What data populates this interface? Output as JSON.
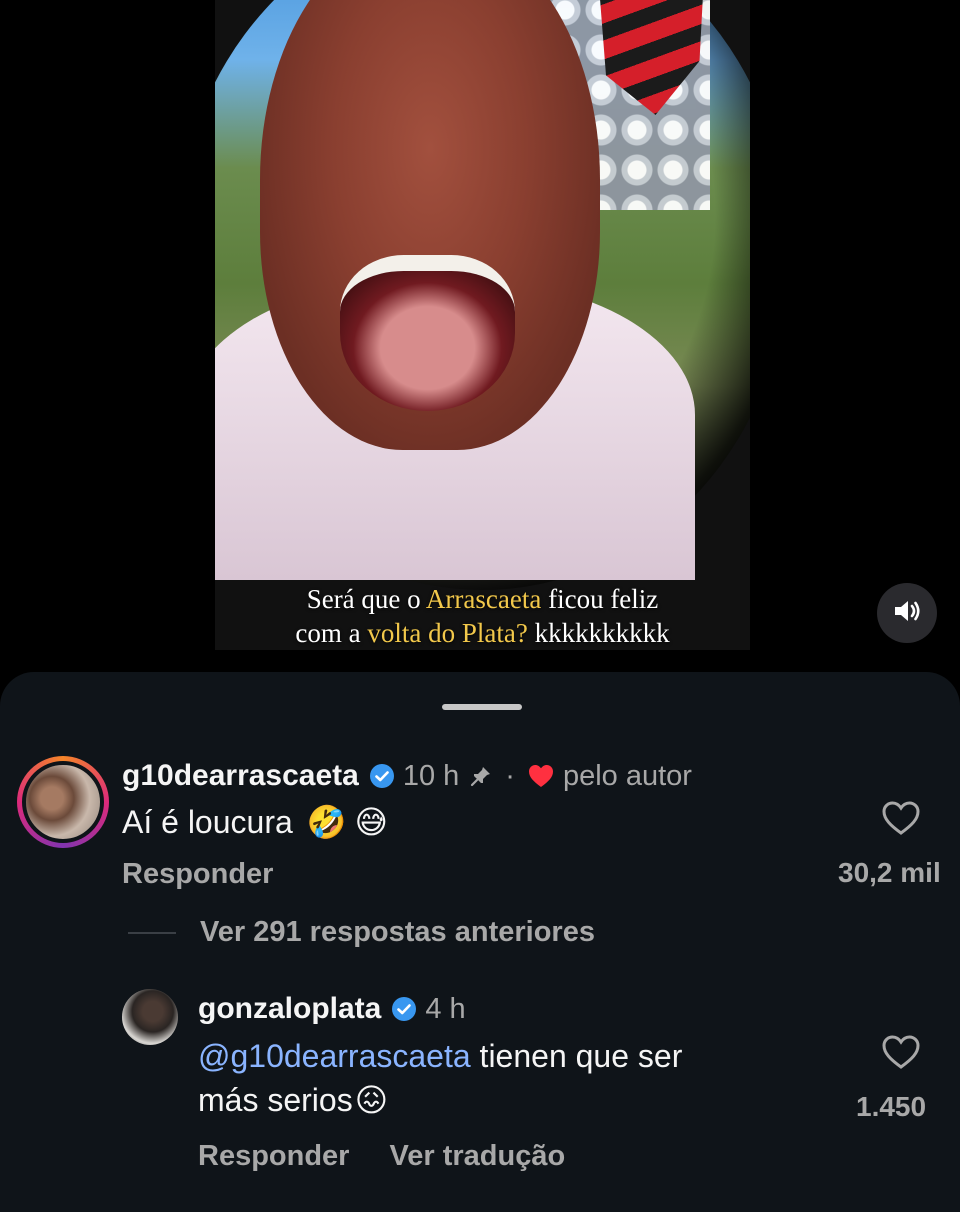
{
  "video": {
    "caption": {
      "line1_before": "Será que o ",
      "line1_highlight": "Arrascaeta",
      "line1_after": " ficou feliz",
      "line2_before": "com a ",
      "line2_highlight": "volta do Plata?",
      "line2_after": " kkkkkkkkkk"
    },
    "mute_icon": "speaker-icon",
    "highlight_color": "#f2c84b"
  },
  "comments": [
    {
      "username": "g10dearrascaeta",
      "verified": true,
      "time": "10 h",
      "pinned": true,
      "separator": "·",
      "liked_by_author_label": "pelo autor",
      "text": "Aí é loucura",
      "emojis": [
        "🤣",
        "😅"
      ],
      "reply_label": "Responder",
      "likes": "30,2 mil"
    }
  ],
  "replies_toggle": {
    "label": "Ver 291 respostas anteriores"
  },
  "replies": [
    {
      "username": "gonzaloplata",
      "verified": true,
      "time": "4 h",
      "mention": "@g10dearrascaeta",
      "text_line1": " tienen que ser",
      "text_line2": "más serios",
      "emoji": "😖",
      "reply_label": "Responder",
      "translate_label": "Ver tradução",
      "likes": "1.450"
    }
  ],
  "colors": {
    "sheet_background": "#0f1419",
    "verified_blue": "#3897f0",
    "heart_red": "#ff3040",
    "mention_blue": "#8ab4ff"
  }
}
